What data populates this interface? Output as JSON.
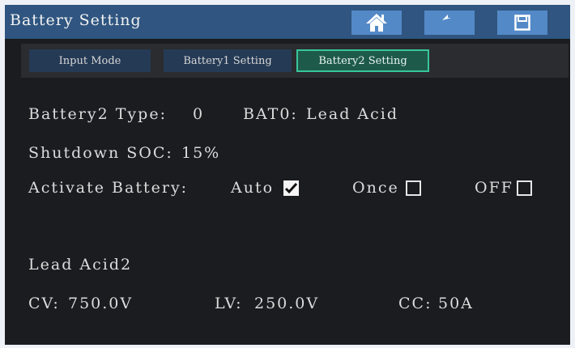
{
  "header": {
    "title": "Battery Setting",
    "buttons": [
      {
        "icon": "home-icon"
      },
      {
        "icon": "back-arrow-icon"
      },
      {
        "icon": "save-icon"
      }
    ]
  },
  "tabs": [
    {
      "label": "Input Mode",
      "active": false
    },
    {
      "label": "Battery1 Setting",
      "active": false
    },
    {
      "label": "Battery2 Setting",
      "active": true
    }
  ],
  "battery_type": {
    "label": "Battery2 Type:",
    "value": "0",
    "bat_label": "BAT0:",
    "bat_value": "Lead Acid"
  },
  "shutdown_soc": {
    "label": "Shutdown SOC:",
    "value": "15%"
  },
  "activate_battery": {
    "label": "Activate Battery:",
    "options": [
      {
        "label": "Auto",
        "checked": true
      },
      {
        "label": "Once",
        "checked": false
      },
      {
        "label": "OFF",
        "checked": false
      }
    ]
  },
  "profile": {
    "name": "Lead Acid2",
    "cv_label": "CV:",
    "cv_value": "750.0V",
    "lv_label": "LV:",
    "lv_value": "250.0V",
    "cc_label": "CC:",
    "cc_value": "50A"
  },
  "colors": {
    "titlebar": "#2f5580",
    "button": "#5489c7",
    "background": "#1a1c1f",
    "active_tab_border": "#37c79a"
  }
}
